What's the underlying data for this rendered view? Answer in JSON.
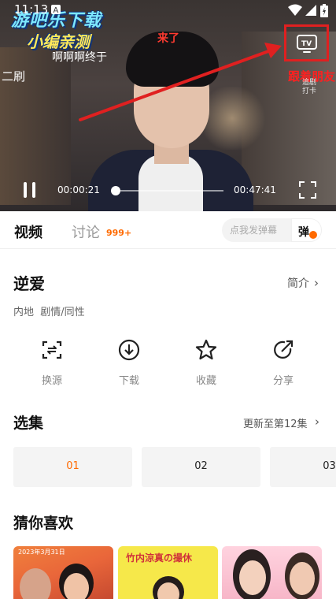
{
  "status_bar": {
    "time": "11:13"
  },
  "player": {
    "watermark": {
      "line1": "游吧乐下载",
      "line2": "小编亲测"
    },
    "danmaku": [
      {
        "text": "二刷"
      },
      {
        "text": "啊啊啊终于"
      },
      {
        "text": "来了"
      },
      {
        "text": "跟着朋友"
      },
      {
        "text": "追剧打卡"
      }
    ],
    "current_time": "00:00:21",
    "total_time": "00:47:41",
    "progress": 0.0073,
    "icons": {
      "tv": "tv-cast-icon",
      "pause": "pause-icon",
      "fullscreen": "fullscreen-icon"
    }
  },
  "tabs": {
    "video": "视频",
    "discuss": "讨论",
    "discuss_count": "999+"
  },
  "danmu": {
    "placeholder": "点我发弹幕",
    "toggle_label": "弹"
  },
  "show": {
    "title": "逆爱",
    "intro_label": "简介",
    "tags": "内地  剧情/同性"
  },
  "actions": [
    {
      "label": "换源",
      "icon": "switch-source-icon"
    },
    {
      "label": "下载",
      "icon": "download-icon"
    },
    {
      "label": "收藏",
      "icon": "star-icon"
    },
    {
      "label": "分享",
      "icon": "share-icon"
    }
  ],
  "episodes_section": {
    "title": "选集",
    "update_label": "更新至第12集",
    "episodes": [
      "01",
      "02",
      "03"
    ],
    "active_index": 0
  },
  "recommend_section": {
    "title": "猜你喜欢",
    "cards": [
      {
        "caption": "2023年3月31日"
      },
      {
        "caption": "竹内涼真の撮休"
      },
      {
        "caption": ""
      }
    ]
  },
  "colors": {
    "accent": "#ff6a00",
    "annotation_red": "#e02020",
    "text_primary": "#111111",
    "text_secondary": "#888888"
  }
}
